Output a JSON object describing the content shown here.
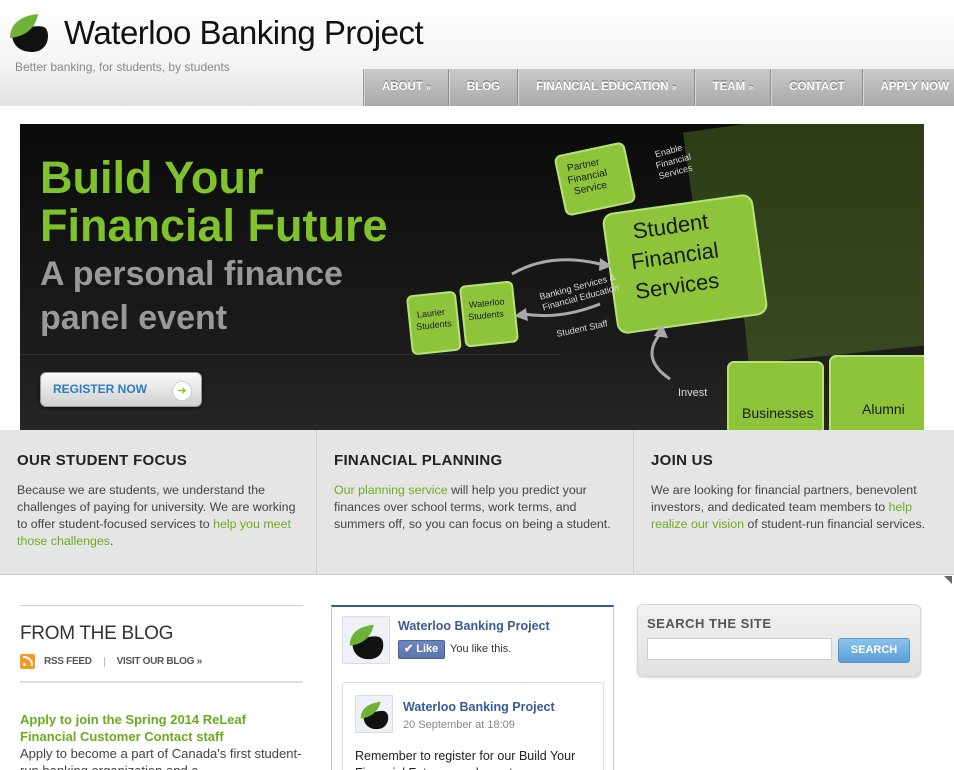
{
  "header": {
    "title": "Waterloo Banking Project",
    "tagline": "Better banking, for students, by students"
  },
  "nav": {
    "items": [
      {
        "label": "ABOUT",
        "has_arrow": true
      },
      {
        "label": "BLOG",
        "has_arrow": false
      },
      {
        "label": "FINANCIAL EDUCATION",
        "has_arrow": true
      },
      {
        "label": "TEAM",
        "has_arrow": true
      },
      {
        "label": "CONTACT",
        "has_arrow": false
      },
      {
        "label": "APPLY NOW",
        "has_arrow": false
      }
    ],
    "arrow": "»"
  },
  "hero": {
    "headline_line1": "Build Your",
    "headline_line2": "Financial Future",
    "subhead_line1": "A personal finance",
    "subhead_line2": "panel event",
    "button_label": "REGISTER NOW",
    "diagram": {
      "partner": [
        "Partner",
        "Financial",
        "Service"
      ],
      "enable": [
        "Enable",
        "Financial",
        "Services"
      ],
      "student_fs": [
        "Student",
        "Financial",
        "Services"
      ],
      "banking": [
        "Banking Services &",
        "Financial Education"
      ],
      "student_staff": "Student Staff",
      "laurier": [
        "Laurier",
        "Students"
      ],
      "waterloo": [
        "Waterloo",
        "Students"
      ],
      "invest": "Invest",
      "businesses": "Businesses",
      "alumni": "Alumni"
    }
  },
  "features": [
    {
      "title": "OUR STUDENT FOCUS",
      "text_before": "Because we are students, we understand the challenges of paying for university. We are working to offer student-focused services to ",
      "link": "help you meet those challenges",
      "text_after": "."
    },
    {
      "title": "FINANCIAL PLANNING",
      "text_before": "",
      "link": "Our planning service",
      "text_after": " will help you predict your finances over school terms, work terms, and summers off, so you can focus on being a student."
    },
    {
      "title": "JOIN US",
      "text_before": "We are looking for financial partners, benevolent investors, and dedicated team members to ",
      "link": "help realize our vision",
      "text_after": " of student-run financial services."
    }
  ],
  "blog": {
    "title": "FROM THE BLOG",
    "rss_label": "RSS FEED",
    "visit_label": "VISIT OUR BLOG »",
    "post_title": "Apply to join the Spring 2014 ReLeaf Financial Customer Contact staff",
    "post_excerpt": "Apply to become a part of Canada's first student-run banking organization and a ..."
  },
  "facebook": {
    "page_name": "Waterloo Banking Project",
    "like_label": "Like",
    "liked_text": "You like this.",
    "post_author": "Waterloo Banking Project",
    "post_date": "20 September at 18:09",
    "post_text": "Remember to register for our Build Your Financial Future panel event on"
  },
  "search": {
    "title": "SEARCH THE SITE",
    "placeholder": "",
    "button_label": "SEARCH"
  },
  "colors": {
    "accent_green": "#7fc22b",
    "link_green": "#6aac1f",
    "nav_gray": "#b5b5b5",
    "facebook_blue": "#3b5998",
    "search_blue": "#5a9fd6"
  }
}
